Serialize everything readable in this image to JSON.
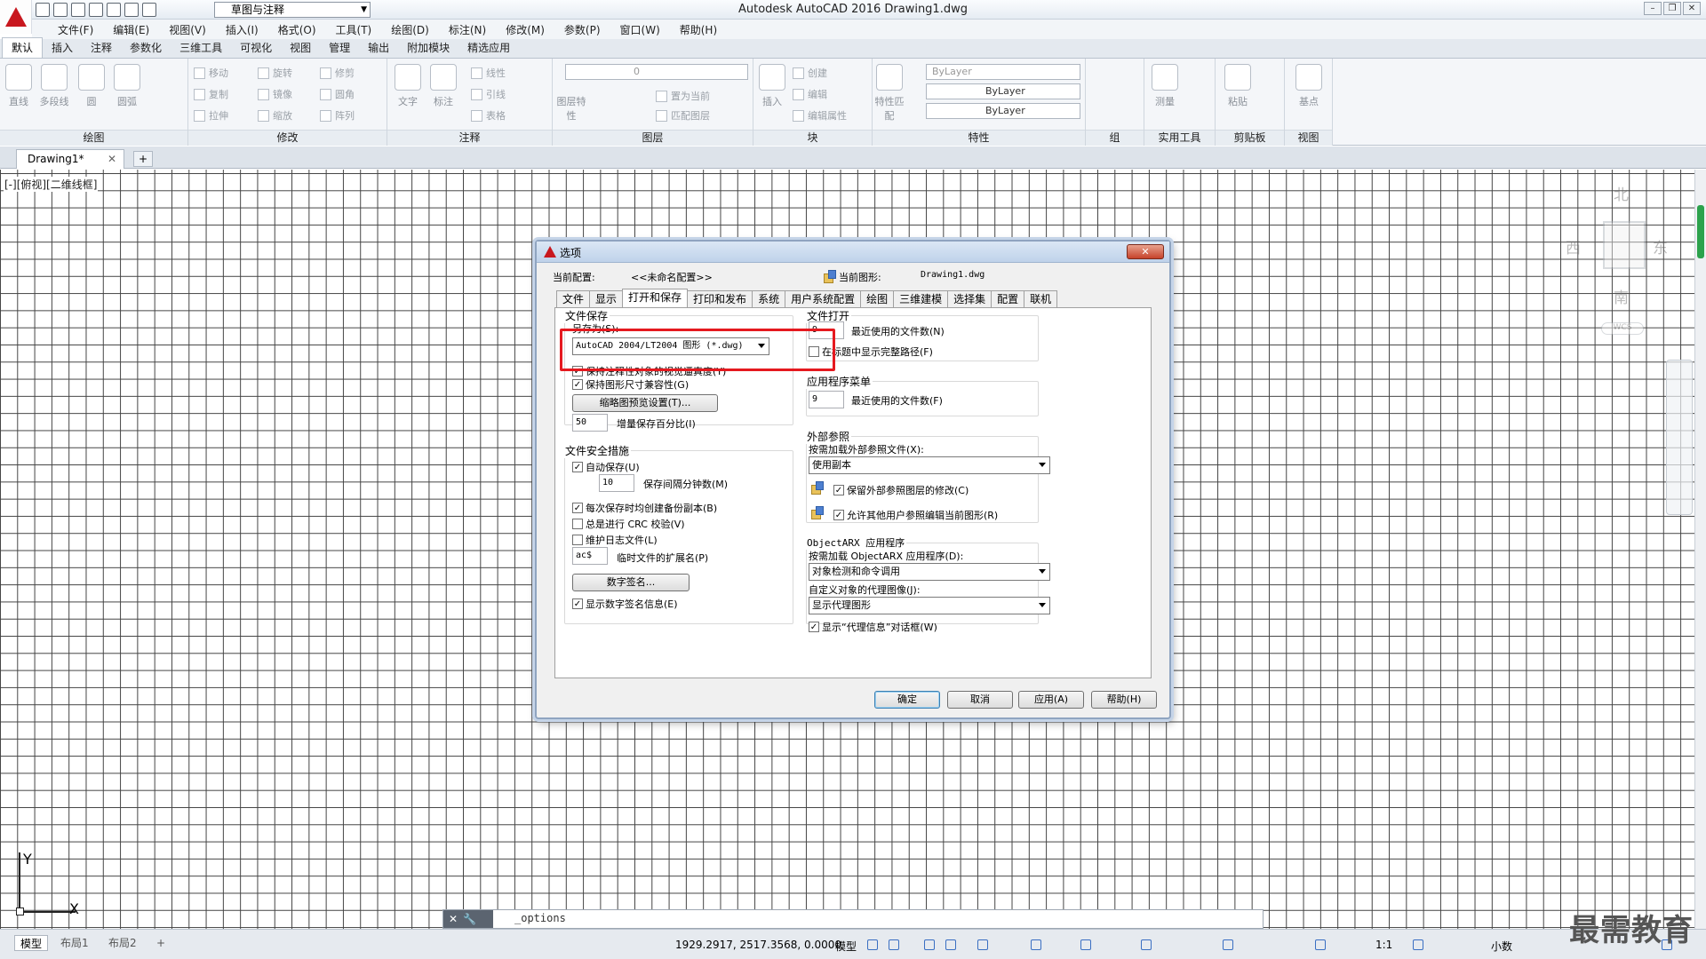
{
  "app": {
    "title": "Autodesk AutoCAD 2016    Drawing1.dwg",
    "workspace": "草图与注释"
  },
  "menubar": [
    "文件(F)",
    "编辑(E)",
    "视图(V)",
    "插入(I)",
    "格式(O)",
    "工具(T)",
    "绘图(D)",
    "标注(N)",
    "修改(M)",
    "参数(P)",
    "窗口(W)",
    "帮助(H)"
  ],
  "ribbon_tabs": [
    "默认",
    "插入",
    "注释",
    "参数化",
    "三维工具",
    "可视化",
    "视图",
    "管理",
    "输出",
    "附加模块",
    "精选应用"
  ],
  "ribbon": {
    "panels": [
      "绘图",
      "修改",
      "注释",
      "图层",
      "块",
      "特性",
      "组",
      "实用工具",
      "剪贴板",
      "视图"
    ],
    "draw_tools": [
      "直线",
      "多段线",
      "圆",
      "圆弧"
    ],
    "modify_tools": [
      "移动",
      "旋转",
      "修剪",
      "复制",
      "镜像",
      "圆角",
      "拉伸",
      "缩放",
      "阵列"
    ],
    "annotate_tools": [
      "文字",
      "标注",
      "线性",
      "引线",
      "表格"
    ],
    "layer_tools": [
      "图层特性",
      "置为当前",
      "匹配图层"
    ],
    "layer_value": "0",
    "block_tools": [
      "插入",
      "创建",
      "编辑",
      "编辑属性"
    ],
    "props_tools": [
      "特性匹配"
    ],
    "bylayer": "ByLayer",
    "util_tools": [
      "测量"
    ],
    "clip_tools": [
      "粘贴"
    ],
    "view_tools": [
      "基点"
    ]
  },
  "file_tab": "Drawing1*",
  "view_label": "[-][俯视][二维线框]",
  "viewcube": {
    "n": "北",
    "s": "南",
    "e": "东",
    "w": "西",
    "wcs": "WCS"
  },
  "ucs": {
    "x": "X",
    "y": "Y"
  },
  "command_line": "_options",
  "status": {
    "layout_tabs": [
      "模型",
      "布局1",
      "布局2"
    ],
    "coords": "1929.2917, 2517.3568, 0.0000",
    "model": "模型",
    "scale": "1:1",
    "units": "小数"
  },
  "watermark": "最需教育",
  "dialog": {
    "title": "选项",
    "current_profile_label": "当前配置:",
    "current_profile_value": "<<未命名配置>>",
    "current_drawing_label": "当前图形:",
    "current_drawing_value": "Drawing1.dwg",
    "tabs": [
      "文件",
      "显示",
      "打开和保存",
      "打印和发布",
      "系统",
      "用户系统配置",
      "绘图",
      "三维建模",
      "选择集",
      "配置",
      "联机"
    ],
    "active_tab": "打开和保存",
    "file_save": {
      "title": "文件保存",
      "save_as_label": "另存为(S):",
      "save_as_value": "AutoCAD 2004/LT2004 图形 (*.dwg)",
      "cb_annotative": "保持注释性对象的视觉逼真度(Y)",
      "cb_dimension": "保持图形尺寸兼容性(G)",
      "thumbnail_btn": "缩略图预览设置(T)...",
      "incremental_value": "50",
      "incremental_label": "增量保存百分比(I)"
    },
    "file_safety": {
      "title": "文件安全措施",
      "autosave": "自动保存(U)",
      "autosave_minutes_value": "10",
      "autosave_minutes_label": "保存间隔分钟数(M)",
      "backup": "每次保存时均创建备份副本(B)",
      "crc": "总是进行 CRC 校验(V)",
      "log": "维护日志文件(L)",
      "temp_ext_value": "ac$",
      "temp_ext_label": "临时文件的扩展名(P)",
      "digsig_btn": "数字签名...",
      "digsig_info": "显示数字签名信息(E)"
    },
    "file_open": {
      "title": "文件打开",
      "recent_value": "9",
      "recent_label": "最近使用的文件数(N)",
      "fullpath": "在标题中显示完整路径(F)"
    },
    "app_menu": {
      "title": "应用程序菜单",
      "recent_value": "9",
      "recent_label": "最近使用的文件数(F)"
    },
    "xref": {
      "title": "外部参照",
      "demand_label": "按需加载外部参照文件(X):",
      "demand_value": "使用副本",
      "retain": "保留外部参照图层的修改(C)",
      "allow": "允许其他用户参照编辑当前图形(R)"
    },
    "objectarx": {
      "title": "ObjectARX 应用程序",
      "demand_label": "按需加载 ObjectARX 应用程序(D):",
      "demand_value": "对象检测和命令调用",
      "proxy_label": "自定义对象的代理图像(J):",
      "proxy_value": "显示代理图形",
      "proxy_info": "显示“代理信息”对话框(W)"
    },
    "buttons": {
      "ok": "确定",
      "cancel": "取消",
      "apply": "应用(A)",
      "help": "帮助(H)"
    },
    "checks": {
      "annotative": "✓",
      "dimension": "✓",
      "autosave": "✓",
      "backup": "✓",
      "crc": "",
      "log": "",
      "digsig": "✓",
      "fullpath": "",
      "retain": "✓",
      "allow": "✓",
      "proxy": "✓"
    }
  },
  "colors": {
    "accent_red": "#e5191f",
    "autodesk_red": "#c8171e",
    "scroll_green": "#2ca24c"
  }
}
